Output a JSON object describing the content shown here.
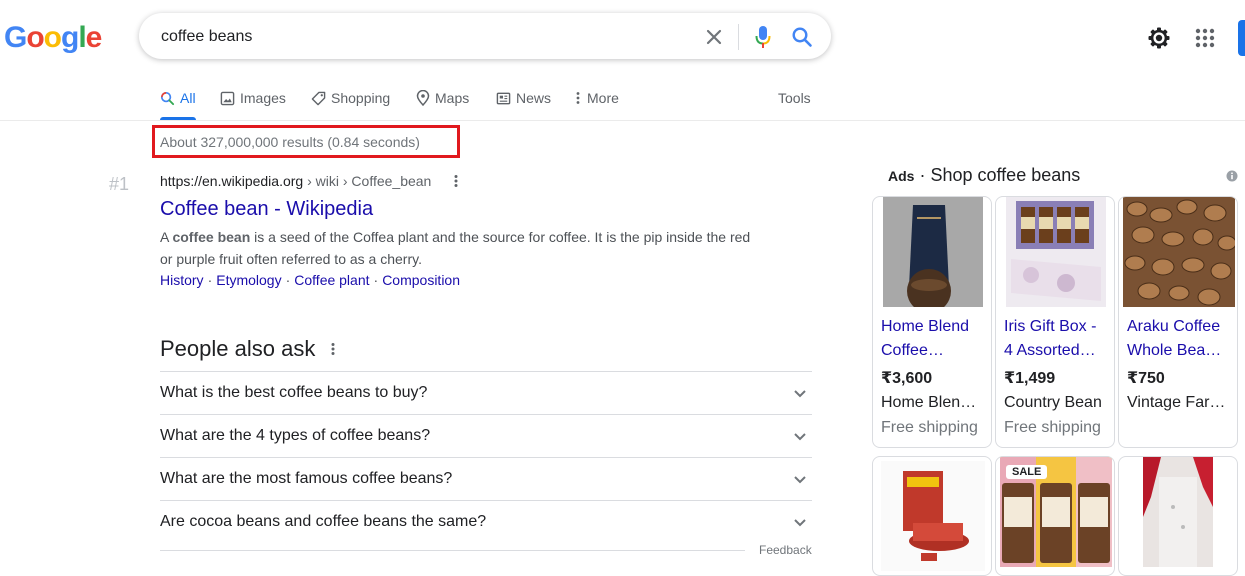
{
  "header": {
    "logo_letters": [
      {
        "ch": "G",
        "color": "#4285f4"
      },
      {
        "ch": "o",
        "color": "#ea4335"
      },
      {
        "ch": "o",
        "color": "#fbbc05"
      },
      {
        "ch": "g",
        "color": "#4285f4"
      },
      {
        "ch": "l",
        "color": "#34a853"
      },
      {
        "ch": "e",
        "color": "#ea4335"
      }
    ],
    "query": "coffee beans"
  },
  "tabs": {
    "all": "All",
    "images": "Images",
    "shopping": "Shopping",
    "maps": "Maps",
    "news": "News",
    "more": "More",
    "tools": "Tools"
  },
  "stats": "About 327,000,000 results (0.84 seconds)",
  "result": {
    "rank": "#1",
    "url": "https://en.wikipedia.org",
    "breadcrumb": " › wiki › Coffee_bean",
    "title": "Coffee bean - Wikipedia",
    "snippet_pre": "A ",
    "snippet_bold": "coffee bean",
    "snippet_post": " is a seed of the Coffea plant and the source for coffee. It is the pip inside the red or purple fruit often referred to as a cherry.",
    "sitelinks": [
      "History",
      "Etymology",
      "Coffee plant",
      "Composition"
    ]
  },
  "paa": {
    "title": "People also ask",
    "questions": [
      "What is the best coffee beans to buy?",
      "What are the 4 types of coffee beans?",
      "What are the most famous coffee beans?",
      "Are cocoa beans and coffee beans the same?"
    ],
    "feedback": "Feedback"
  },
  "ads": {
    "label": "Ads",
    "sep": " · ",
    "title": "Shop coffee beans",
    "products": [
      {
        "title1": "Home Blend",
        "title2": "Coffee…",
        "price": "₹3,600",
        "merchant": "Home Blen…",
        "shipping": "Free shipping"
      },
      {
        "title1": "Iris Gift Box -",
        "title2": "4 Assorted…",
        "price": "₹1,499",
        "merchant": "Country Bean",
        "shipping": "Free shipping"
      },
      {
        "title1": "Araku Coffee",
        "title2": "Whole Bea…",
        "price": "₹750",
        "merchant": "Vintage Far…",
        "shipping": ""
      }
    ],
    "sale_badge": "SALE"
  },
  "colors": {
    "link": "#1a0dab",
    "accent": "#1a73e8",
    "highlight_box": "#e1191e"
  }
}
